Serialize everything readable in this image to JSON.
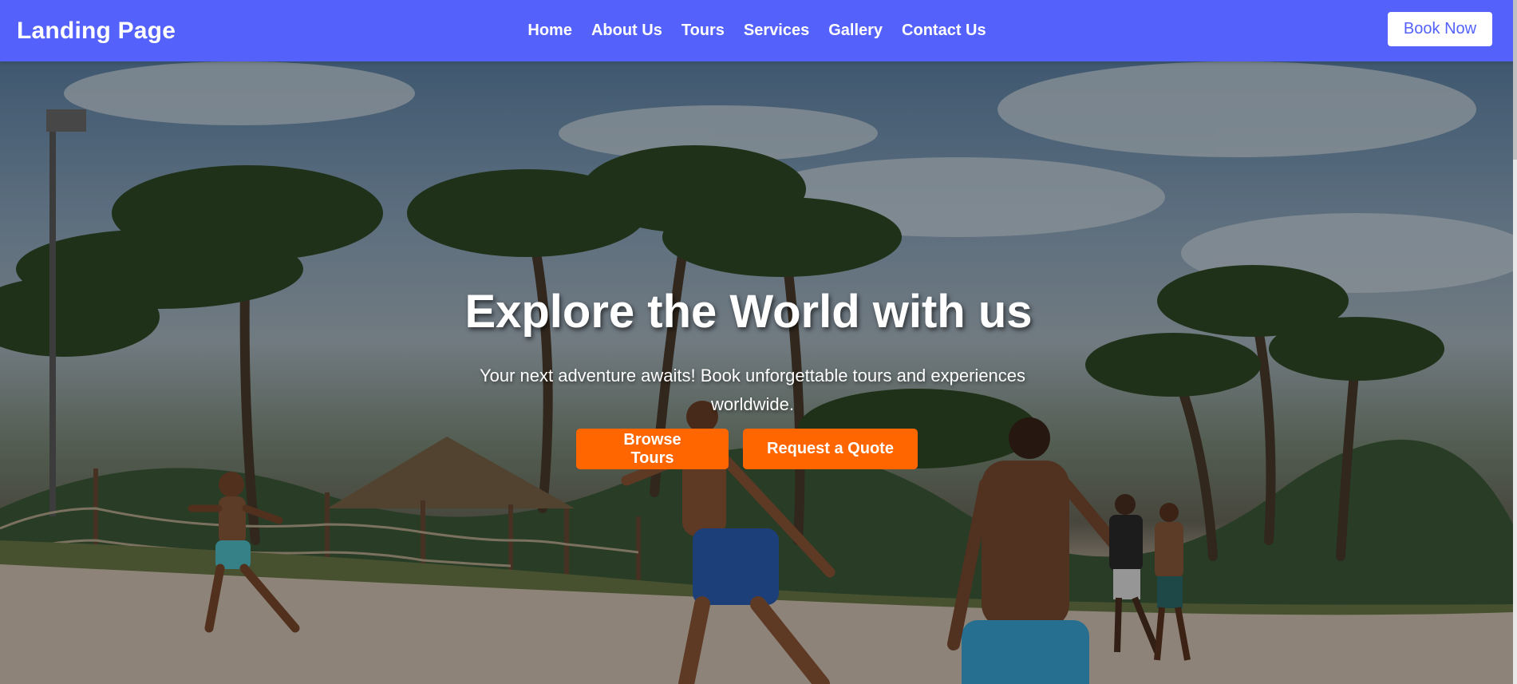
{
  "brand": {
    "title": "Landing Page"
  },
  "nav": {
    "links": [
      "Home",
      "About Us",
      "Tours",
      "Services",
      "Gallery",
      "Contact Us"
    ],
    "book_label": "Book Now"
  },
  "hero": {
    "title": "Explore the World with us",
    "subtitle": "Your next adventure awaits! Book unforgettable tours and experiences worldwide.",
    "primary_button": "Browse Tours",
    "secondary_button": "Request a Quote",
    "background_image": "beach-palm-trees-photo"
  },
  "colors": {
    "nav_bg": "#5462fb",
    "accent": "#ff6600",
    "text_light": "#ffffff"
  }
}
